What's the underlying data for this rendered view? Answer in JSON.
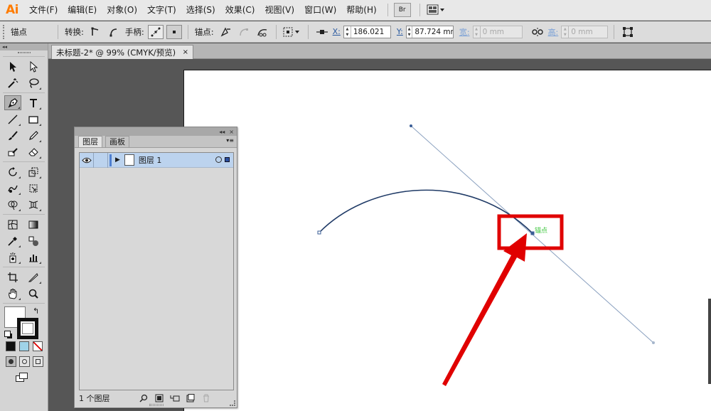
{
  "app": {
    "logo": "Ai",
    "menus": [
      "文件(F)",
      "编辑(E)",
      "对象(O)",
      "文字(T)",
      "选择(S)",
      "效果(C)",
      "视图(V)",
      "窗口(W)",
      "帮助(H)"
    ],
    "bridge_button": "Br",
    "workspace_icon": "arrange-documents-icon"
  },
  "control_bar": {
    "selection_type": "锚点",
    "convert_label": "转换:",
    "handles_label": "手柄:",
    "anchors_label": "锚点:",
    "x_label": "X:",
    "x_value": "186.021",
    "y_label": "Y:",
    "y_value": "87.724 mm",
    "width_label": "宽:",
    "width_value": "0 mm",
    "height_label": "高:",
    "height_value": "0 mm"
  },
  "document": {
    "tab_title": "未标题-2* @ 99% (CMYK/预览)",
    "close_glyph": "×"
  },
  "canvas": {
    "anchor_label": "锚点",
    "highlight_color": "#e00000",
    "arrow_color": "#e00000",
    "path_color": "#1f3a66",
    "handle_color": "#7f97b8"
  },
  "layers_panel": {
    "collapse_glyph": "◂◂",
    "close_glyph": "×",
    "tabs": [
      "图层",
      "画板"
    ],
    "menu_glyph": "▾≡",
    "layer": {
      "name": "图层 1",
      "visible": true,
      "expand_glyph": "▶"
    },
    "layer_count": "1 个图层"
  },
  "toolbox": {
    "collapse_glyph": "◂◂"
  }
}
